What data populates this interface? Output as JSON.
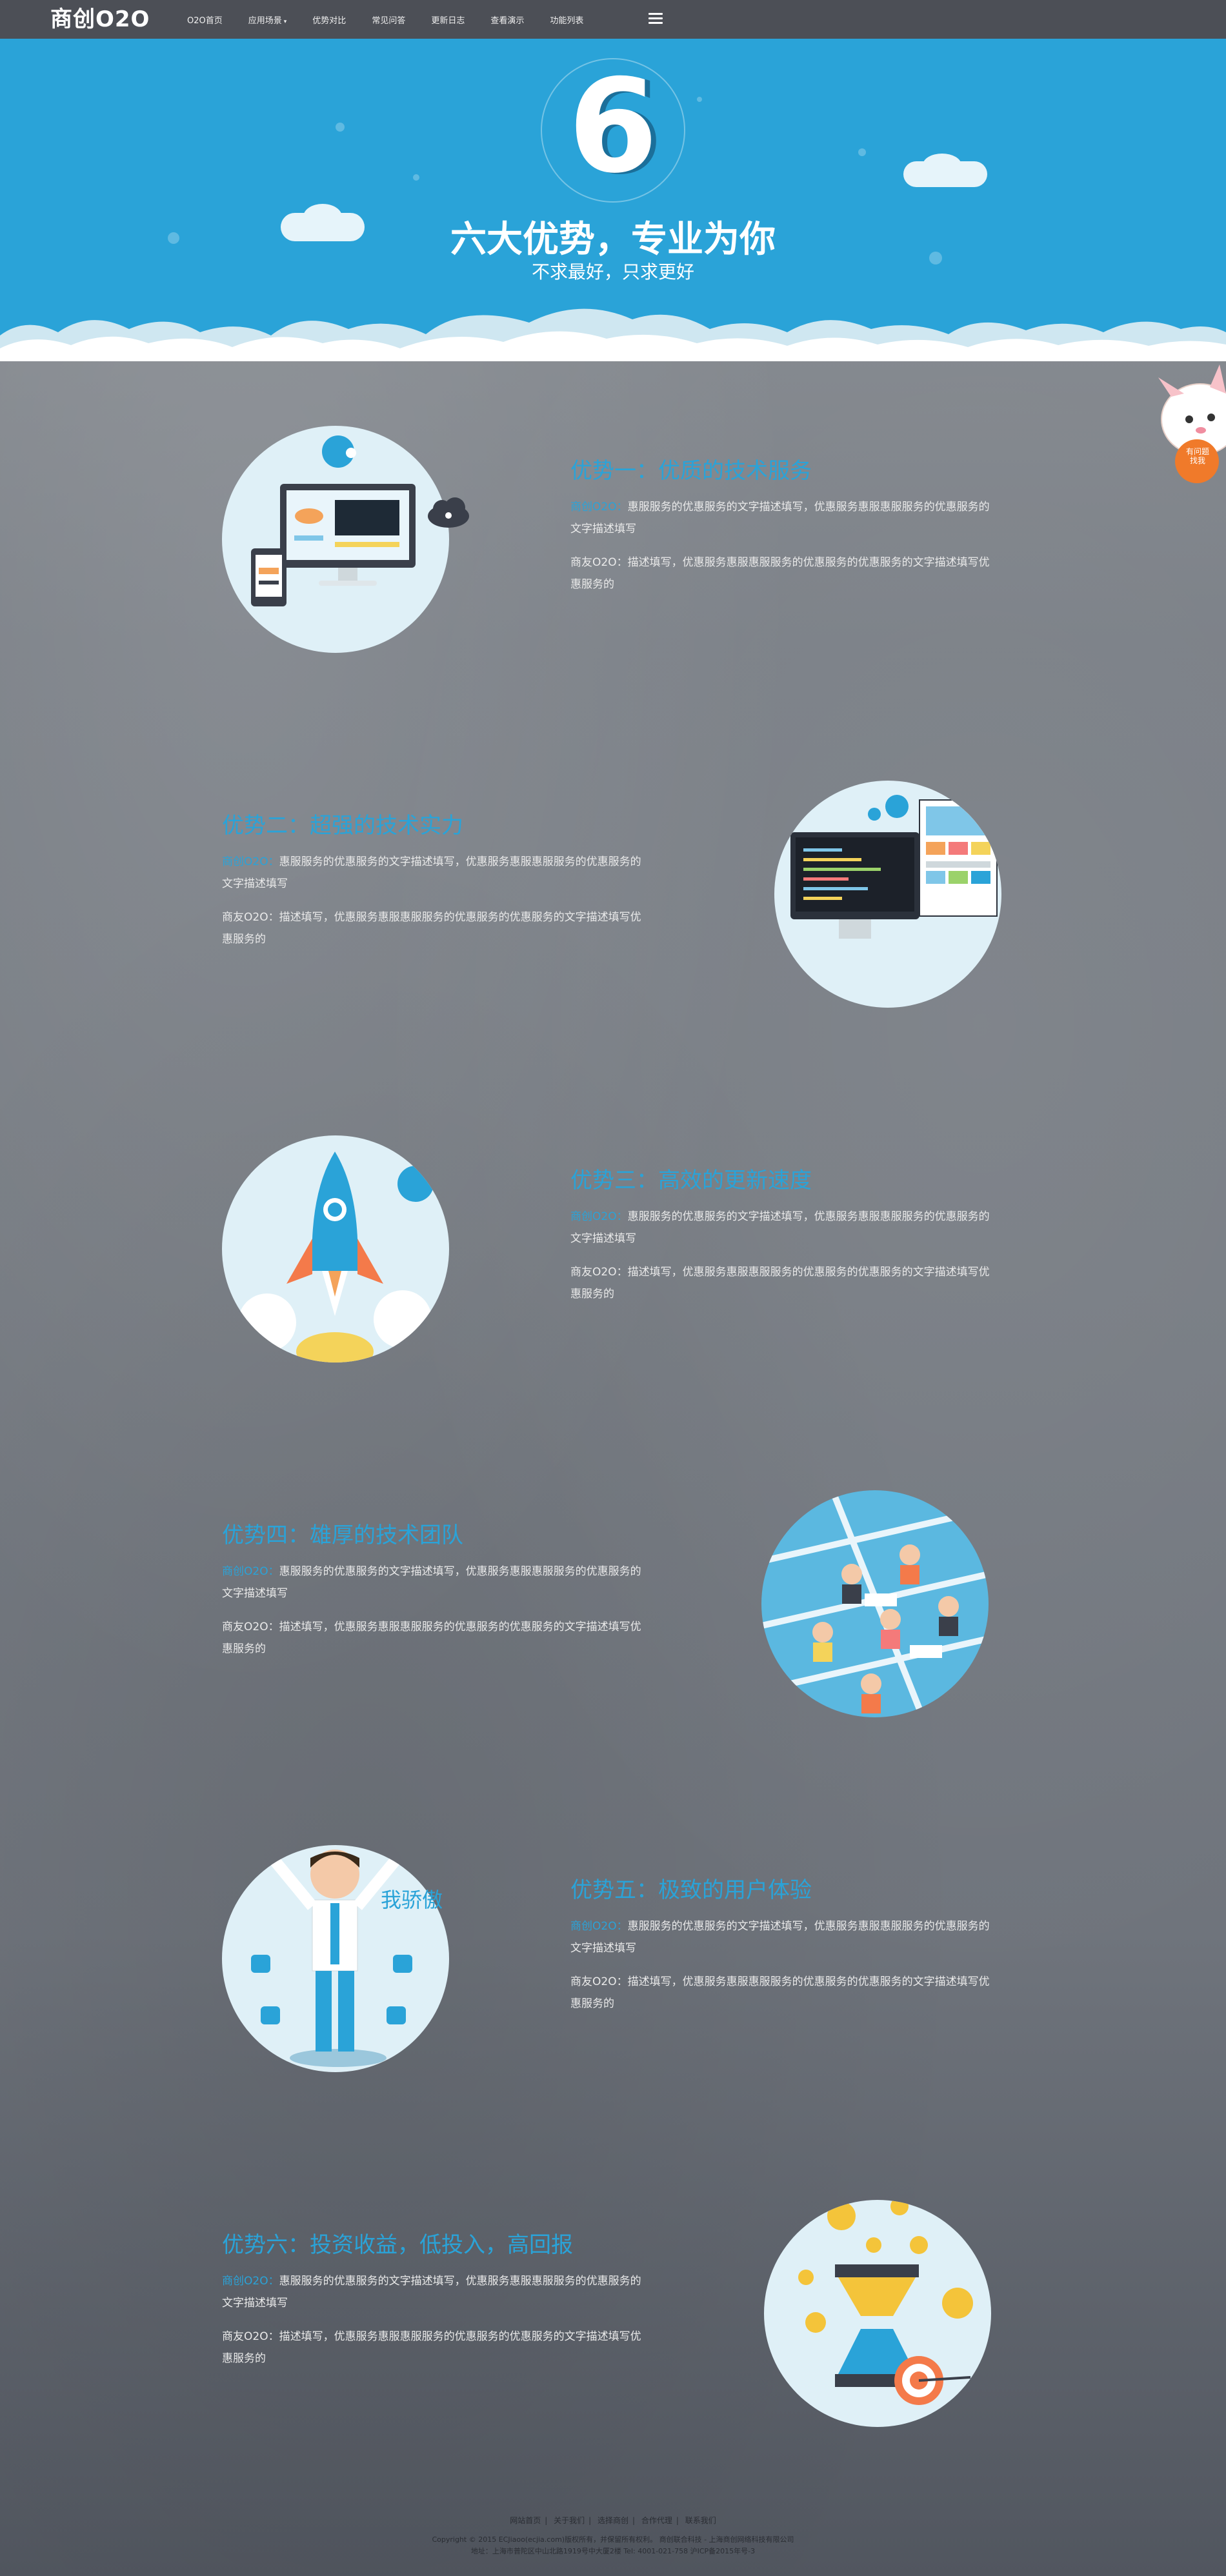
{
  "navbar": {
    "logo": "商创O2O",
    "items": [
      {
        "label": "O2O首页"
      },
      {
        "label": "应用场景",
        "has_caret": true
      },
      {
        "label": "优势对比"
      },
      {
        "label": "常见问答"
      },
      {
        "label": "更新日志"
      },
      {
        "label": "查看演示"
      },
      {
        "label": "功能列表"
      }
    ],
    "menu_icon": "hamburger-icon"
  },
  "hero": {
    "number": "6",
    "title": "六大优势，专业为你",
    "subtitle": "不求最好，只求更好",
    "background": "#2aa3d8"
  },
  "mascot": {
    "line1": "有问题",
    "line2": "找我"
  },
  "features": [
    {
      "title": "优势一：优质的技术服务",
      "p1_highlight": "商创O2O：",
      "p1": "惠服服务的优惠服务的文字描述填写，优惠服务惠服惠服服务的优惠服务的文字描述填写",
      "p2": "商友O2O：描述填写，优惠服务惠服惠服服务的优惠服务的优惠服务的文字描述填写优惠服务的",
      "illustration": "computer-devices-icon"
    },
    {
      "title": "优势二：超强的技术实力",
      "p1_highlight": "商创O2O：",
      "p1": "惠服服务的优惠服务的文字描述填写，优惠服务惠服惠服服务的优惠服务的文字描述填写",
      "p2": "商友O2O：描述填写，优惠服务惠服惠服服务的优惠服务的优惠服务的文字描述填写优惠服务的",
      "illustration": "code-monitor-icon"
    },
    {
      "title": "优势三：高效的更新速度",
      "p1_highlight": "商创O2O：",
      "p1": "惠服服务的优惠服务的文字描述填写，优惠服务惠服惠服服务的优惠服务的文字描述填写",
      "p2": "商友O2O：描述填写，优惠服务惠服惠服服务的优惠服务的优惠服务的文字描述填写优惠服务的",
      "illustration": "rocket-icon"
    },
    {
      "title": "优势四：雄厚的技术团队",
      "p1_highlight": "商创O2O：",
      "p1": "惠服服务的优惠服务的文字描述填写，优惠服务惠服惠服服务的优惠服务的文字描述填写",
      "p2": "商友O2O：描述填写，优惠服务惠服惠服服务的优惠服务的优惠服务的文字描述填写优惠服务的",
      "illustration": "team-office-icon"
    },
    {
      "title": "优势五：极致的用户体验",
      "p1_highlight": "商创O2O：",
      "p1": "惠服服务的优惠服务的文字描述填写，优惠服务惠服惠服服务的优惠服务的文字描述填写",
      "p2": "商友O2O：描述填写，优惠服务惠服惠服服务的优惠服务的优惠服务的文字描述填写优惠服务的",
      "badge": "我骄傲",
      "illustration": "happy-man-icon"
    },
    {
      "title": "优势六：投资收益，低投入，高回报",
      "p1_highlight": "商创O2O：",
      "p1": "惠服服务的优惠服务的文字描述填写，优惠服务惠服惠服服务的优惠服务的文字描述填写",
      "p2": "商友O2O：描述填写，优惠服务惠服惠服服务的优惠服务的优惠服务的文字描述填写优惠服务的",
      "illustration": "coins-hourglass-icon"
    }
  ],
  "footer": {
    "links": [
      "网站首页",
      "关于我们",
      "选择商创",
      "合作代理",
      "联系我们"
    ],
    "copyright": "Copyright © 2015 ECJiaoo(ecjia.com)版权所有，并保留所有权利。 商创联合科技 - 上海商创网络科技有限公司",
    "address": "地址：上海市普陀区中山北路1919号中大厦2楼    Tel: 4001-021-758    沪ICP备2015年号-3"
  },
  "colors": {
    "accent": "#2aa3d8",
    "navbar": "#464a50",
    "body_text": "#eaeaea"
  }
}
